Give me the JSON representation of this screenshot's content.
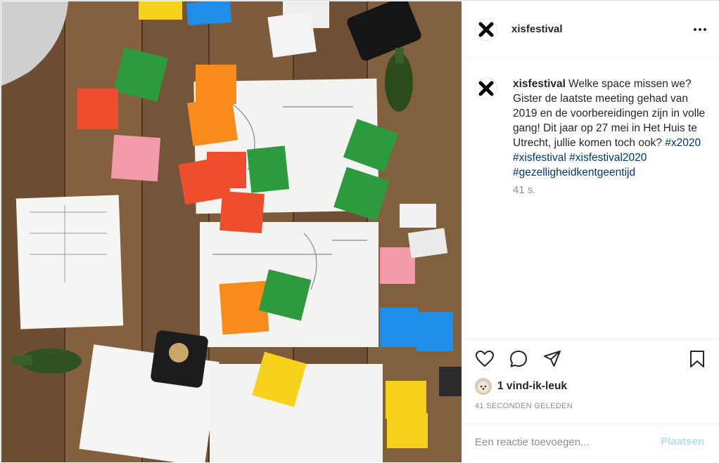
{
  "post": {
    "username": "xisfestival",
    "photo_alt": "photo-of-planning-table",
    "caption": {
      "username": "xisfestival",
      "text": "Welke space missen we? Gister de laatste meeting gehad van 2019 en de voorbereidingen zijn in volle gang! Dit jaar op 27 mei in Het Huis te Utrecht, jullie komen toch ook?",
      "hashtags": [
        "#x2020",
        "#xisfestival",
        "#xisfestival2020",
        "#gezelligheidkentgeentijd"
      ],
      "time_ago": "41 s."
    },
    "likes_text": "1 vind-ik-leuk",
    "timestamp": "41 SECONDEN GELEDEN",
    "comment": {
      "placeholder": "Een reactie toevoegen...",
      "post_label": "Plaatsen"
    },
    "icons": {
      "avatar": "x-logo-icon",
      "more": "more-options-icon",
      "like": "heart-icon",
      "comment": "comment-bubble-icon",
      "share": "paper-plane-icon",
      "save": "bookmark-icon"
    },
    "colors": {
      "accent": "#00376b",
      "post_button": "#b2dffc",
      "muted": "#8e8e8e"
    }
  }
}
